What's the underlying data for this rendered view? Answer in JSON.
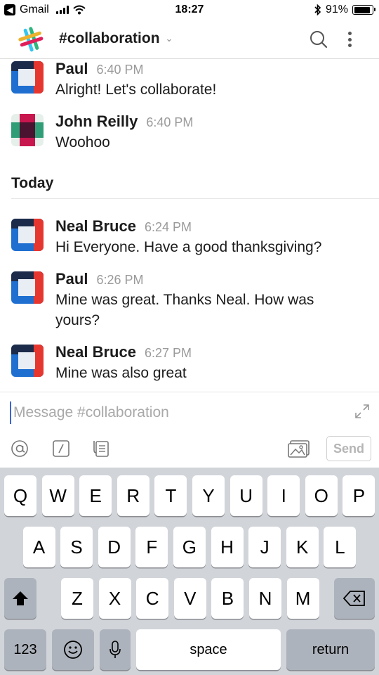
{
  "status_bar": {
    "back_app": "Gmail",
    "time": "18:27",
    "battery": "91%",
    "battery_level": 0.91
  },
  "header": {
    "channel_hash": "#",
    "channel_name": "collaboration",
    "icons": [
      "slack-logo-icon",
      "search-icon",
      "more-vertical-icon"
    ]
  },
  "messages_before": [
    {
      "author": "Paul",
      "time": "6:40 PM",
      "text": "Alright!  Let's collaborate!",
      "avatar": "blue-red-avatar"
    },
    {
      "author": "John Reilly",
      "time": "6:40 PM",
      "text": "Woohoo",
      "avatar": "green-pink-avatar"
    }
  ],
  "day_divider": "Today",
  "messages_today": [
    {
      "author": "Neal Bruce",
      "time": "6:24 PM",
      "text": "Hi Everyone. Have a good thanksgiving?",
      "avatar": "blue-red-avatar"
    },
    {
      "author": "Paul",
      "time": "6:26 PM",
      "text": "Mine was great. Thanks Neal. How was yours?",
      "avatar": "blue-red-avatar"
    },
    {
      "author": "Neal Bruce",
      "time": "6:27 PM",
      "text": "Mine was also great",
      "avatar": "blue-red-avatar"
    }
  ],
  "composer": {
    "placeholder": "Message #collaboration",
    "value": "",
    "send_label": "Send",
    "tools": [
      "mention-icon",
      "slash-command-icon",
      "attach-file-icon",
      "photo-icon",
      "expand-icon"
    ]
  },
  "keyboard": {
    "row1": [
      "Q",
      "W",
      "E",
      "R",
      "T",
      "Y",
      "U",
      "I",
      "O",
      "P"
    ],
    "row2": [
      "A",
      "S",
      "D",
      "F",
      "G",
      "H",
      "J",
      "K",
      "L"
    ],
    "row3": [
      "Z",
      "X",
      "C",
      "V",
      "B",
      "N",
      "M"
    ],
    "numbers_label": "123",
    "space_label": "space",
    "return_label": "return"
  },
  "colors": {
    "accent": "#3c63d8",
    "keyboard_bg": "#d1d4d9",
    "muted_text": "#9a9a9a"
  }
}
